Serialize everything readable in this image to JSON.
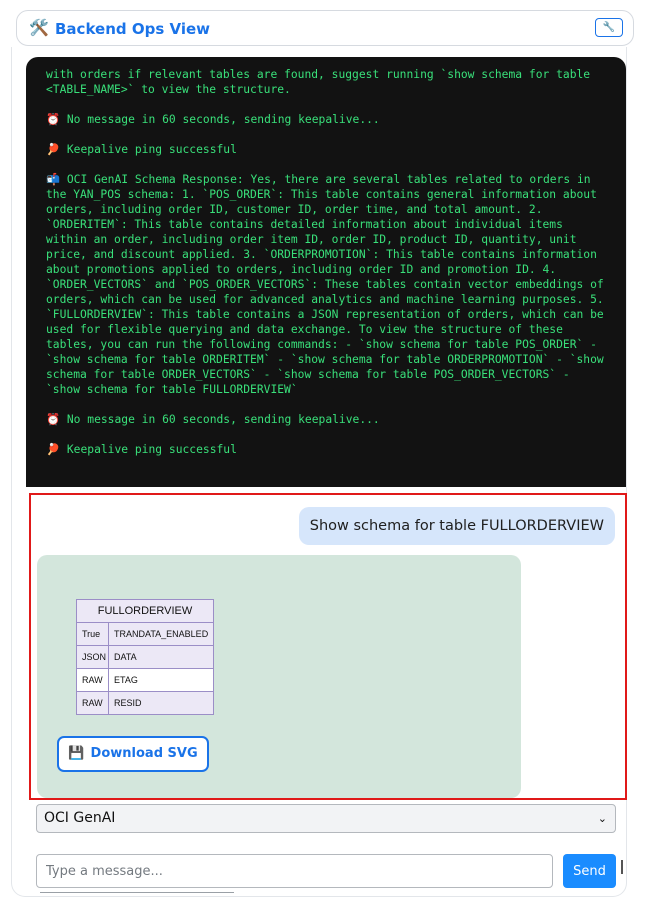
{
  "header": {
    "icon": "tools-icon",
    "icon_glyph": "🛠️",
    "title": "Backend Ops View",
    "button_glyph": "🔧",
    "accent": "#1a73e8"
  },
  "terminal": {
    "messages": [
      {
        "text": "with orders if relevant tables are found, suggest running `show schema for table <TABLE_NAME>` to view the structure."
      },
      {
        "text": "⏰ No message in 60 seconds, sending keepalive..."
      },
      {
        "text": "🏓 Keepalive ping successful"
      },
      {
        "text": "📬 OCI GenAI Schema Response: Yes, there are several tables related to orders in the YAN_POS schema: 1. `POS_ORDER`: This table contains general information about orders, including order ID, customer ID, order time, and total amount. 2. `ORDERITEM`: This table contains detailed information about individual items within an order, including order item ID, order ID, product ID, quantity, unit price, and discount applied. 3. `ORDERPROMOTION`: This table contains information about promotions applied to orders, including order ID and promotion ID. 4. `ORDER_VECTORS` and `POS_ORDER_VECTORS`: These tables contain vector embeddings of orders, which can be used for advanced analytics and machine learning purposes. 5. `FULLORDERVIEW`: This table contains a JSON representation of orders, which can be used for flexible querying and data exchange. To view the structure of these tables, you can run the following commands: - `show schema for table POS_ORDER` - `show schema for table ORDERITEM` - `show schema for table ORDERPROMOTION` - `show schema for table ORDER_VECTORS` - `show schema for table POS_ORDER_VECTORS` - `show schema for table FULLORDERVIEW`"
      },
      {
        "text": "⏰ No message in 60 seconds, sending keepalive..."
      },
      {
        "text": "🏓 Keepalive ping successful"
      }
    ],
    "text_color": "#39e07a"
  },
  "chat": {
    "user_message": "Show schema for table FULLORDERVIEW",
    "diagram": {
      "table_name": "FULLORDERVIEW",
      "columns": [
        {
          "type": "True",
          "name": "TRANDATA_ENABLED"
        },
        {
          "type": "JSON",
          "name": "DATA"
        },
        {
          "type": "RAW",
          "name": "ETAG"
        },
        {
          "type": "RAW",
          "name": "RESID"
        }
      ]
    },
    "download_label": "Download SVG",
    "download_icon_glyph": "💾"
  },
  "model_select": {
    "selected": "OCI GenAI",
    "chevron": "⌄"
  },
  "composer": {
    "placeholder": "Type a message...",
    "send_label": "Send"
  }
}
